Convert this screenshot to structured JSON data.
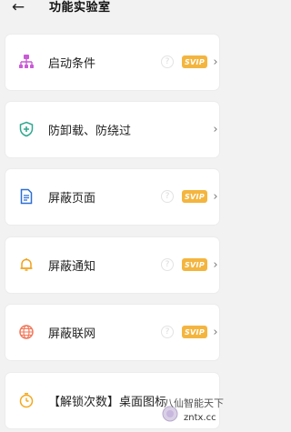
{
  "header": {
    "back_icon": "←",
    "title": "功能实验室"
  },
  "items": [
    {
      "label": "启动条件",
      "icon": "network-icon",
      "help": "?",
      "badge": "SVIP",
      "chevron": "›"
    },
    {
      "label": "防卸载、防绕过",
      "icon": "shield-plus-icon",
      "chevron": "›"
    },
    {
      "label": "屏蔽页面",
      "icon": "document-icon",
      "help": "?",
      "badge": "SVIP",
      "chevron": "›"
    },
    {
      "label": "屏蔽通知",
      "icon": "bell-icon",
      "help": "?",
      "badge": "SVIP",
      "chevron": "›"
    },
    {
      "label": "屏蔽联网",
      "icon": "globe-icon",
      "help": "?",
      "badge": "SVIP",
      "chevron": "›"
    },
    {
      "label": "【解锁次数】桌面图标",
      "icon": "timer-icon"
    }
  ],
  "watermark": {
    "line1": "八仙智能天下",
    "line2": "zntx.cc"
  },
  "colors": {
    "svip": "#f4b53f",
    "network": "#c95bd6",
    "shield": "#2fa88f",
    "document": "#2b6fd6",
    "bell": "#f0a21b",
    "globe": "#f2785a",
    "timer": "#f3a81c"
  }
}
